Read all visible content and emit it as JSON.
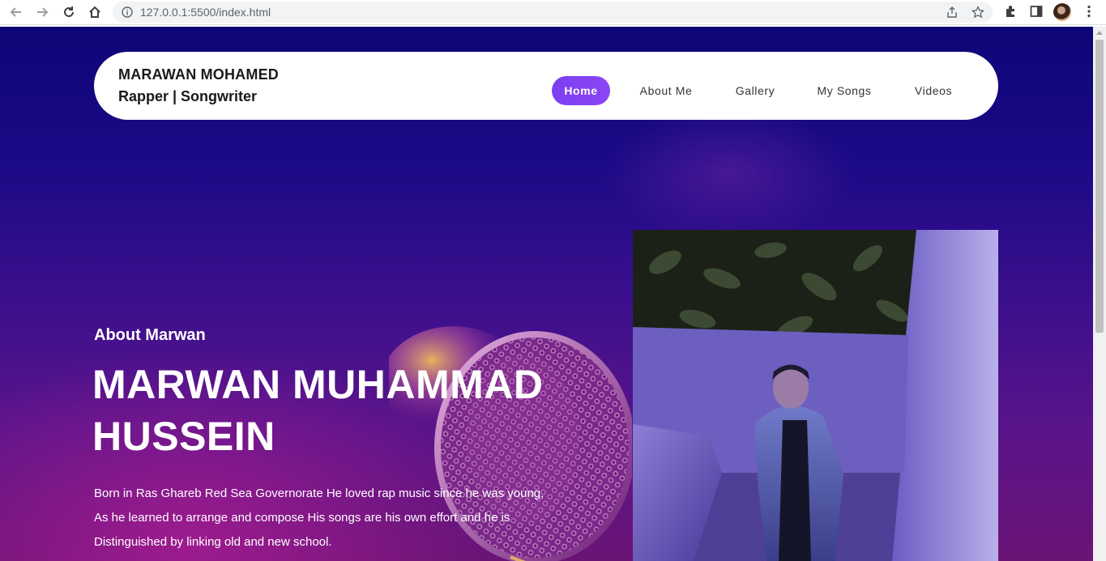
{
  "browser": {
    "url": "127.0.0.1:5500/index.html"
  },
  "header": {
    "brand_name": "MARAWAN MOHAMED",
    "brand_tagline": "Rapper | Songwriter",
    "nav": [
      {
        "label": "Home",
        "active": true
      },
      {
        "label": "About Me",
        "active": false
      },
      {
        "label": "Gallery",
        "active": false
      },
      {
        "label": "My Songs",
        "active": false
      },
      {
        "label": "Videos",
        "active": false
      }
    ]
  },
  "hero": {
    "subtitle": "About Marwan",
    "name_line1": "MARWAN MUHAMMAD",
    "name_line2": "HUSSEIN",
    "bio_lines": [
      "Born in Ras Ghareb Red Sea Governorate He loved rap music since he was young,",
      "As he learned to arrange and compose His songs are his own effort and he is",
      "Distinguished by linking old and new school."
    ]
  },
  "colors": {
    "accent": "#7c3aed",
    "background_top": "#0e0578",
    "background_bottom": "#6a1476"
  }
}
